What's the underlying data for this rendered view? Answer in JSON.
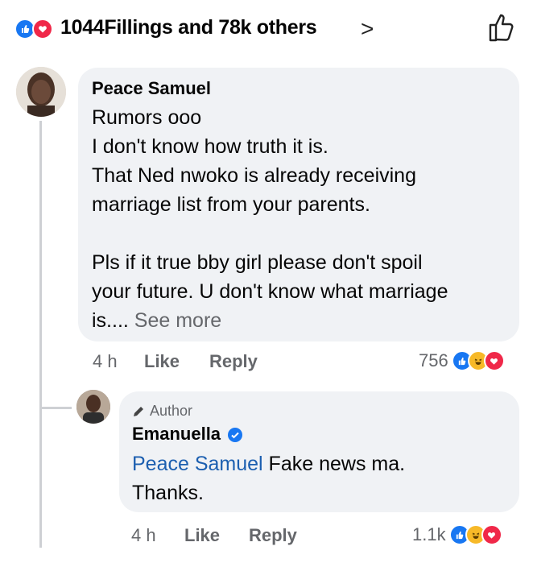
{
  "header": {
    "reactors_text": "1044Fillings and 78k others",
    "chevron": ">",
    "icons": [
      "like-reaction-icon",
      "love-reaction-icon",
      "thumbs-up-outline-icon"
    ]
  },
  "comment": {
    "author": "Peace Samuel",
    "lines": [
      "Rumors ooo",
      "I don't know how truth it is.",
      "That Ned nwoko is already receiving",
      "marriage list from your parents."
    ],
    "lines2": [
      "Pls if it true bby girl please don't spoil",
      "your future. U don't know what marriage"
    ],
    "last_line_prefix": "is....",
    "see_more": "See more",
    "time": "4 h",
    "like": "Like",
    "reply": "Reply",
    "reaction_count": "756"
  },
  "reply": {
    "author_badge": "Author",
    "author": "Emanuella",
    "mention": "Peace Samuel",
    "text_after_mention": " Fake news ma.",
    "line2": "Thanks.",
    "time": "4 h",
    "like": "Like",
    "reply": "Reply",
    "reaction_count": "1.1k"
  },
  "colors": {
    "like_blue": "#1877f2",
    "love_red": "#f02849",
    "haha_yellow": "#f7b928",
    "bubble_bg": "#f0f2f5",
    "secondary_text": "#65676b",
    "mention_blue": "#1c5fb0"
  }
}
